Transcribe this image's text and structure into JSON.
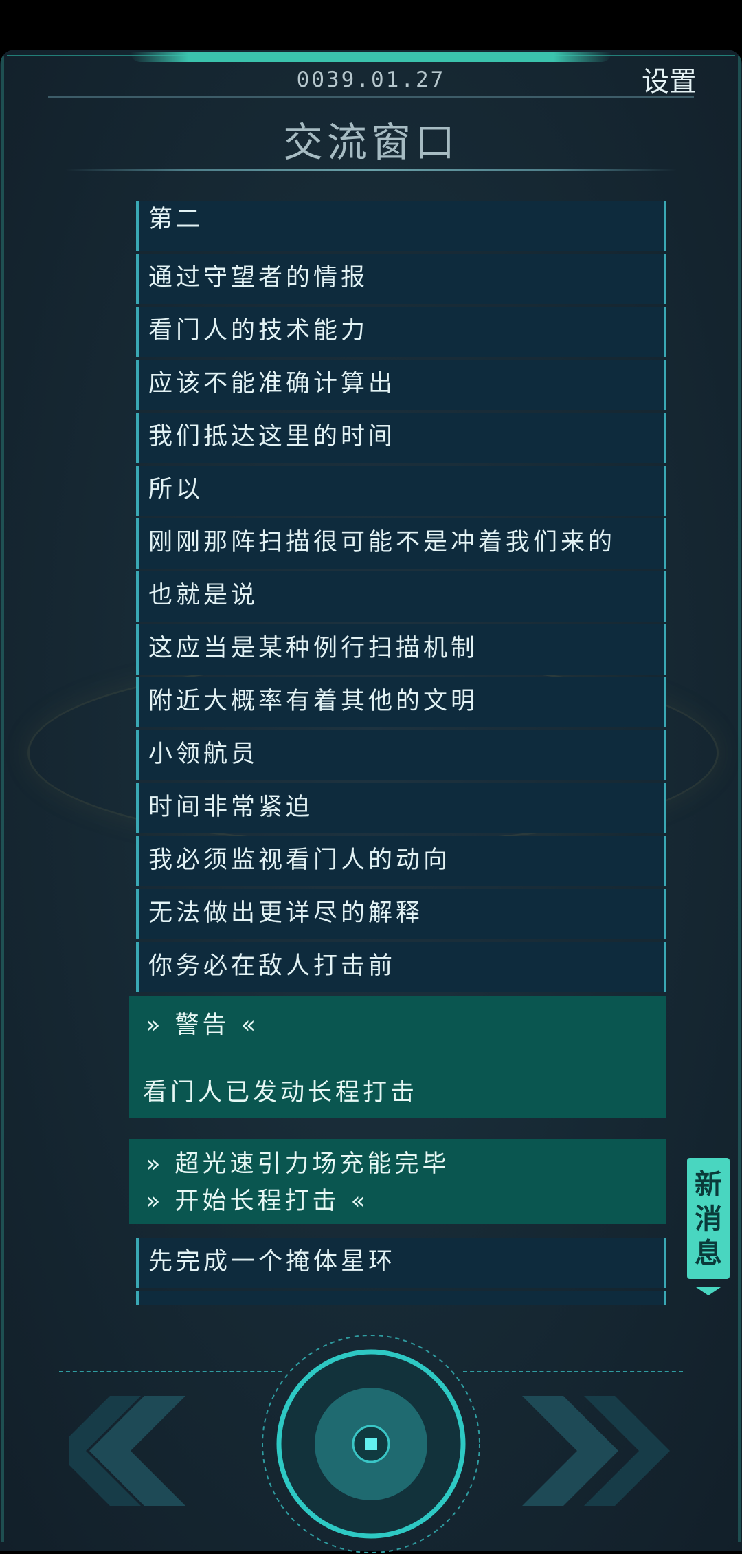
{
  "header": {
    "date": "0039.01.27",
    "settings_label": "设置",
    "title": "交流窗口"
  },
  "messages": [
    "第二",
    "通过守望者的情报",
    "看门人的技术能力",
    "应该不能准确计算出",
    "我们抵达这里的时间",
    "所以",
    "刚刚那阵扫描很可能不是冲着我们来的",
    "也就是说",
    "这应当是某种例行扫描机制",
    "附近大概率有着其他的文明",
    "小领航员",
    "时间非常紧迫",
    "我必须监视看门人的动向",
    "无法做出更详尽的解释",
    "你务必在敌人打击前"
  ],
  "alert_warning": {
    "heading": "» 警告 «",
    "body": "看门人已发动长程打击"
  },
  "alert_ftl": {
    "line1": "» 超光速引力场充能完毕",
    "line2": "» 开始长程打击 «"
  },
  "messages_after": [
    "先完成一个掩体星环"
  ],
  "new_message_badge": {
    "label_1": "新",
    "label_2": "消",
    "label_3": "息"
  },
  "colors": {
    "accent": "#49d6c0",
    "message_bg": "#0e2b3d",
    "alert_bg": "#0a5650",
    "background": "#162833"
  },
  "icons": {
    "previous": "double-chevron-left-icon",
    "next": "double-chevron-right-icon",
    "center": "core-button-icon",
    "new_message": "chevron-down-icon"
  }
}
